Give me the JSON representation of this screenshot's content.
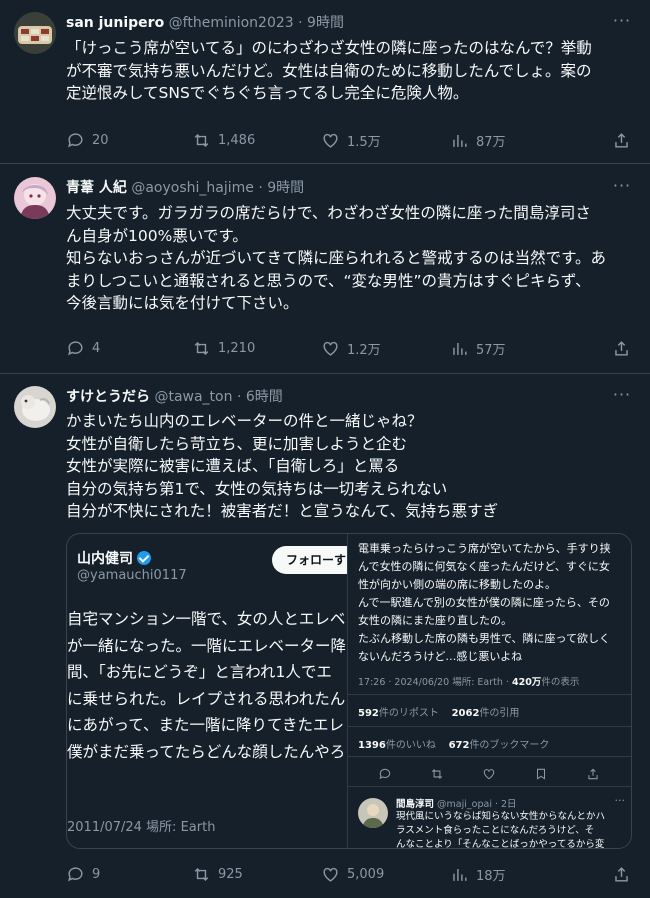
{
  "tweets": [
    {
      "name": "san junipero",
      "handle": "@ftheminion2023",
      "time": "9時間",
      "lines": [
        "「けっこう席が空いてる」のにわざわざ女性の隣に座ったのはなんで？挙動",
        "が不審で気持ち悪いんだけど。女性は自衛のために移動したんでしょ。案の",
        "定逆恨みしてSNSでぐちぐち言ってるし完全に危険人物。"
      ],
      "replies": "20",
      "reposts": "1,486",
      "likes": "1.5万",
      "views": "87万"
    },
    {
      "name": "青葦 人紀",
      "handle": "@aoyoshi_hajime",
      "time": "9時間",
      "lines": [
        "大丈夫です。ガラガラの席だらけで、わざわざ女性の隣に座った間島淳司さ",
        "ん自身が100%悪いです。",
        "知らないおっさんが近づいてきて隣に座られれると警戒するのは当然です。あ",
        "まりしつこいと通報されると思うので、“変な男性”の貴方はすぐピキらず、",
        "今後言動には気を付けて下さい。"
      ],
      "replies": "4",
      "reposts": "1,210",
      "likes": "1.2万",
      "views": "57万"
    },
    {
      "name": "すけとうだら",
      "handle": "@tawa_ton",
      "time": "6時間",
      "lines": [
        "かまいたち山内のエレベーターの件と一緒じゃね？",
        "女性が自衛したら苛立ち、更に加害しようと企む",
        "女性が実際に被害に遭えば、「自衛しろ」と罵る",
        "自分の気持ち第1で、女性の気持ちは一切考えられない",
        "自分が不快にされた！被害者だ！と宣うなんて、気持ち悪すぎ"
      ],
      "replies": "9",
      "reposts": "925",
      "likes": "5,009",
      "views": "18万"
    }
  ],
  "embed": {
    "name": "山内健司",
    "handle": "@yamauchi0117",
    "follow_label": "フォローする",
    "lines": [
      "自宅マンション一階で、女の人とエレベ",
      "が一緒になった。一階にエレベーター降",
      "間、「お先にどうぞ」と言われ1人でエ",
      "に乗せられた。レイプされる思われたん",
      "にあがって、また一階に降りてきたエレ",
      "僕がまだ乗ってたらどんな顔したんやろ"
    ],
    "date": "2011/07/24  場所: Earth"
  },
  "panel": {
    "lines": [
      "電車乗ったらけっこう席が空いてたから、手すり挟",
      "んで女性の隣に何気なく座ったんだけど、すぐに女",
      "性が向かい側の端の席に移動したのよ。",
      "んで一駅進んで別の女性が僕の隣に座ったら、その",
      "女性の隣にまた座り直したの。",
      "たぶん移動した席の隣も男性で、隣に座って欲しく",
      "ないんだろうけど…感じ悪いよね"
    ],
    "meta_prefix": "17:26 · 2024/06/20  場所: Earth · ",
    "views_value": "420万",
    "views_suffix": "件の表示",
    "reposts_value": "592",
    "reposts_suffix": "件のリポスト",
    "quotes_value": "2062",
    "quotes_suffix": "件の引用",
    "likes_value": "1396",
    "likes_suffix": "件のいいね",
    "bookmarks_value": "672",
    "bookmarks_suffix": "件のブックマーク",
    "reply": {
      "name": "間島淳司",
      "handle": "@maji_opai · 2日",
      "lines": [
        "現代風にいうならば知らない女性からなんとかハ",
        "ラスメント食らったことになんだろうけど、そ",
        "んなことより「そんなことばっかやってるから変"
      ]
    }
  }
}
